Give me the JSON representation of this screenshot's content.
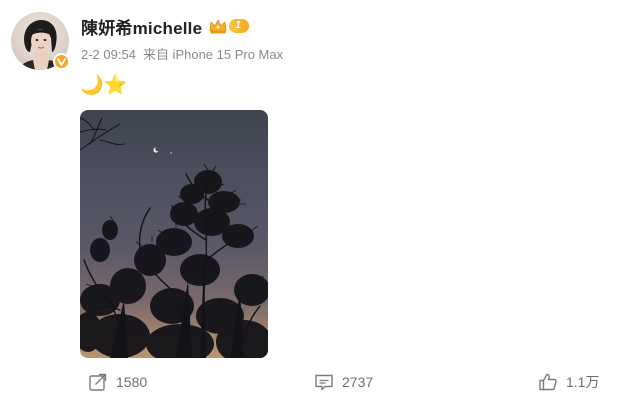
{
  "user": {
    "name": "陳妍希michelle",
    "vip_level": "1",
    "avatar_icon": "user-avatar-photo",
    "verify_icon": "verified-v-icon"
  },
  "post": {
    "date_time": "2-2 09:54",
    "source": "来自 iPhone 15 Pro Max",
    "text": "🌙⭐",
    "image_alt": "night sky with crescent moon and tree silhouettes"
  },
  "actions": {
    "share_count": "1580",
    "comment_count": "2737",
    "like_count": "1.1万"
  },
  "colors": {
    "username": "#222222",
    "meta": "#8a8a8a",
    "vip_gold": "#f2a81b",
    "action_gray": "#6e6e6e"
  }
}
